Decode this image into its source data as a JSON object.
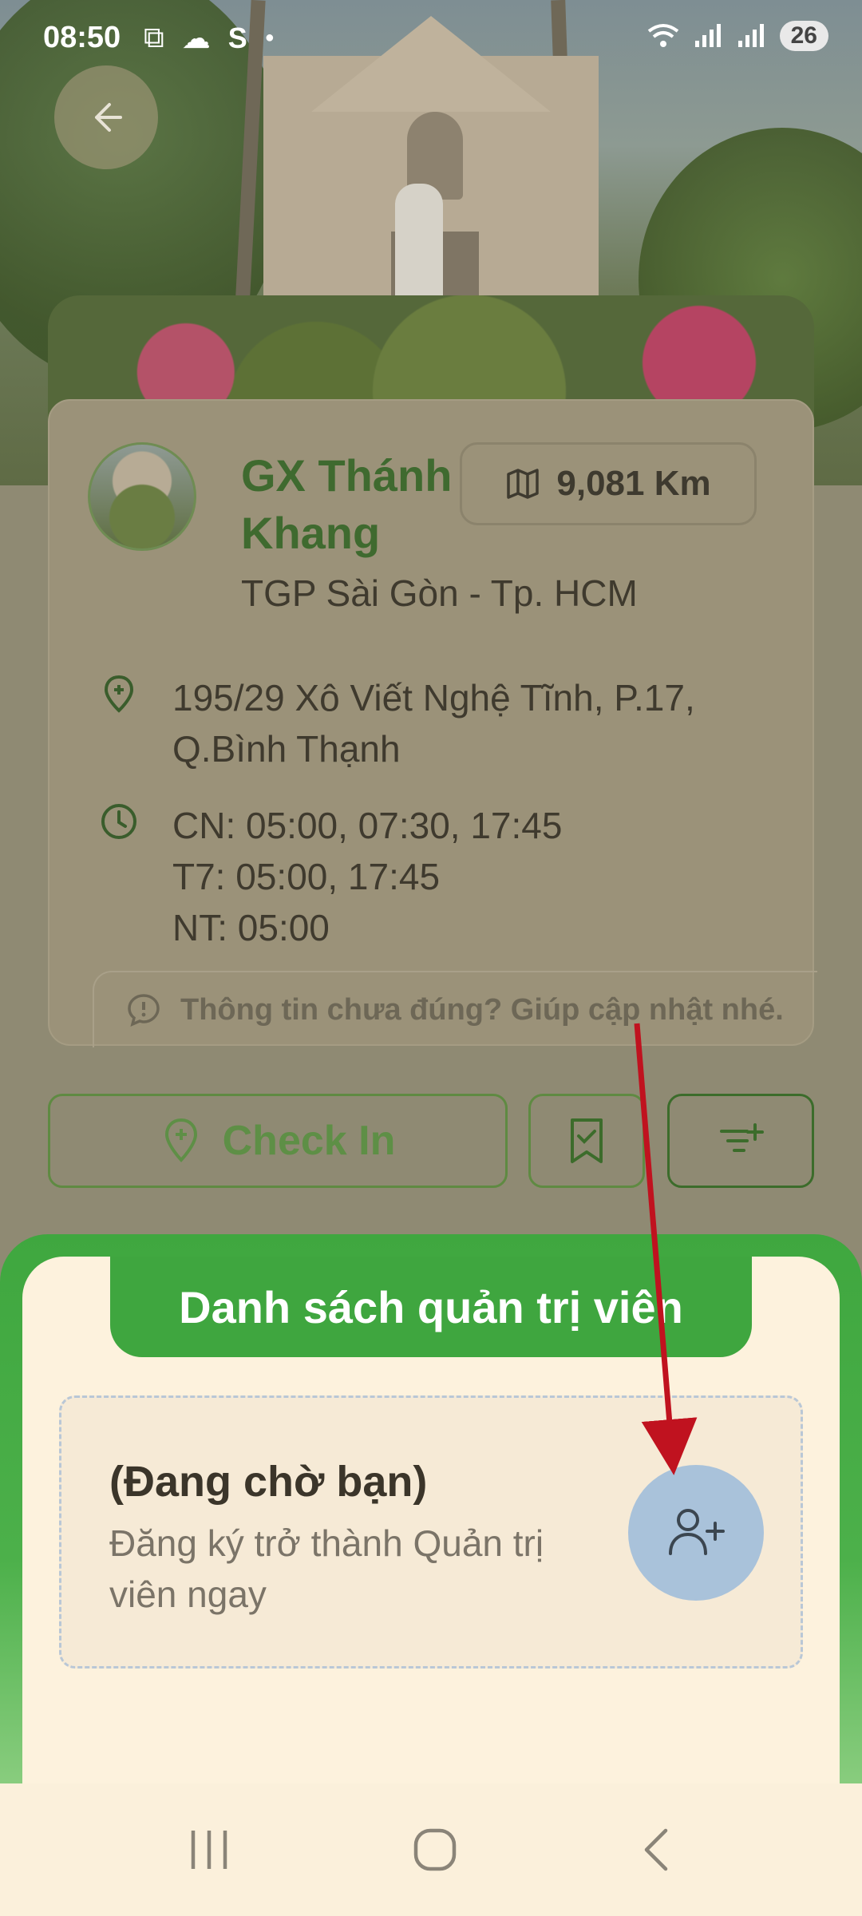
{
  "status_bar": {
    "time": "08:50",
    "left_icons": [
      "screenshot-icon",
      "cloud-icon",
      "s-app-icon",
      "dot-icon"
    ],
    "right_icons": [
      "wifi-icon",
      "signal-icon",
      "signal-icon"
    ],
    "battery": "26"
  },
  "parish": {
    "name": "GX Thánh Khang",
    "distance": "9,081 Km",
    "diocese": "TGP Sài Gòn - Tp. HCM",
    "address": "195/29 Xô Viết Nghệ Tĩnh, P.17, Q.Bình Thạnh",
    "mass_times": [
      "CN: 05:00, 07:30, 17:45",
      "T7: 05:00, 17:45",
      "NT: 05:00"
    ],
    "report_text": "Thông tin chưa đúng? Giúp cập nhật nhé."
  },
  "actions": {
    "checkin_label": "Check In"
  },
  "admin_sheet": {
    "title": "Danh sách quản trị viên",
    "pending_heading": "(Đang chờ bạn)",
    "pending_desc": "Đăng ký trở thành Quản trị viên ngay"
  },
  "colors": {
    "accent_green": "#3fa63f",
    "title_green": "#3f6a2f",
    "add_button_blue": "#a9c2da",
    "annotation_red": "#c0121f"
  }
}
